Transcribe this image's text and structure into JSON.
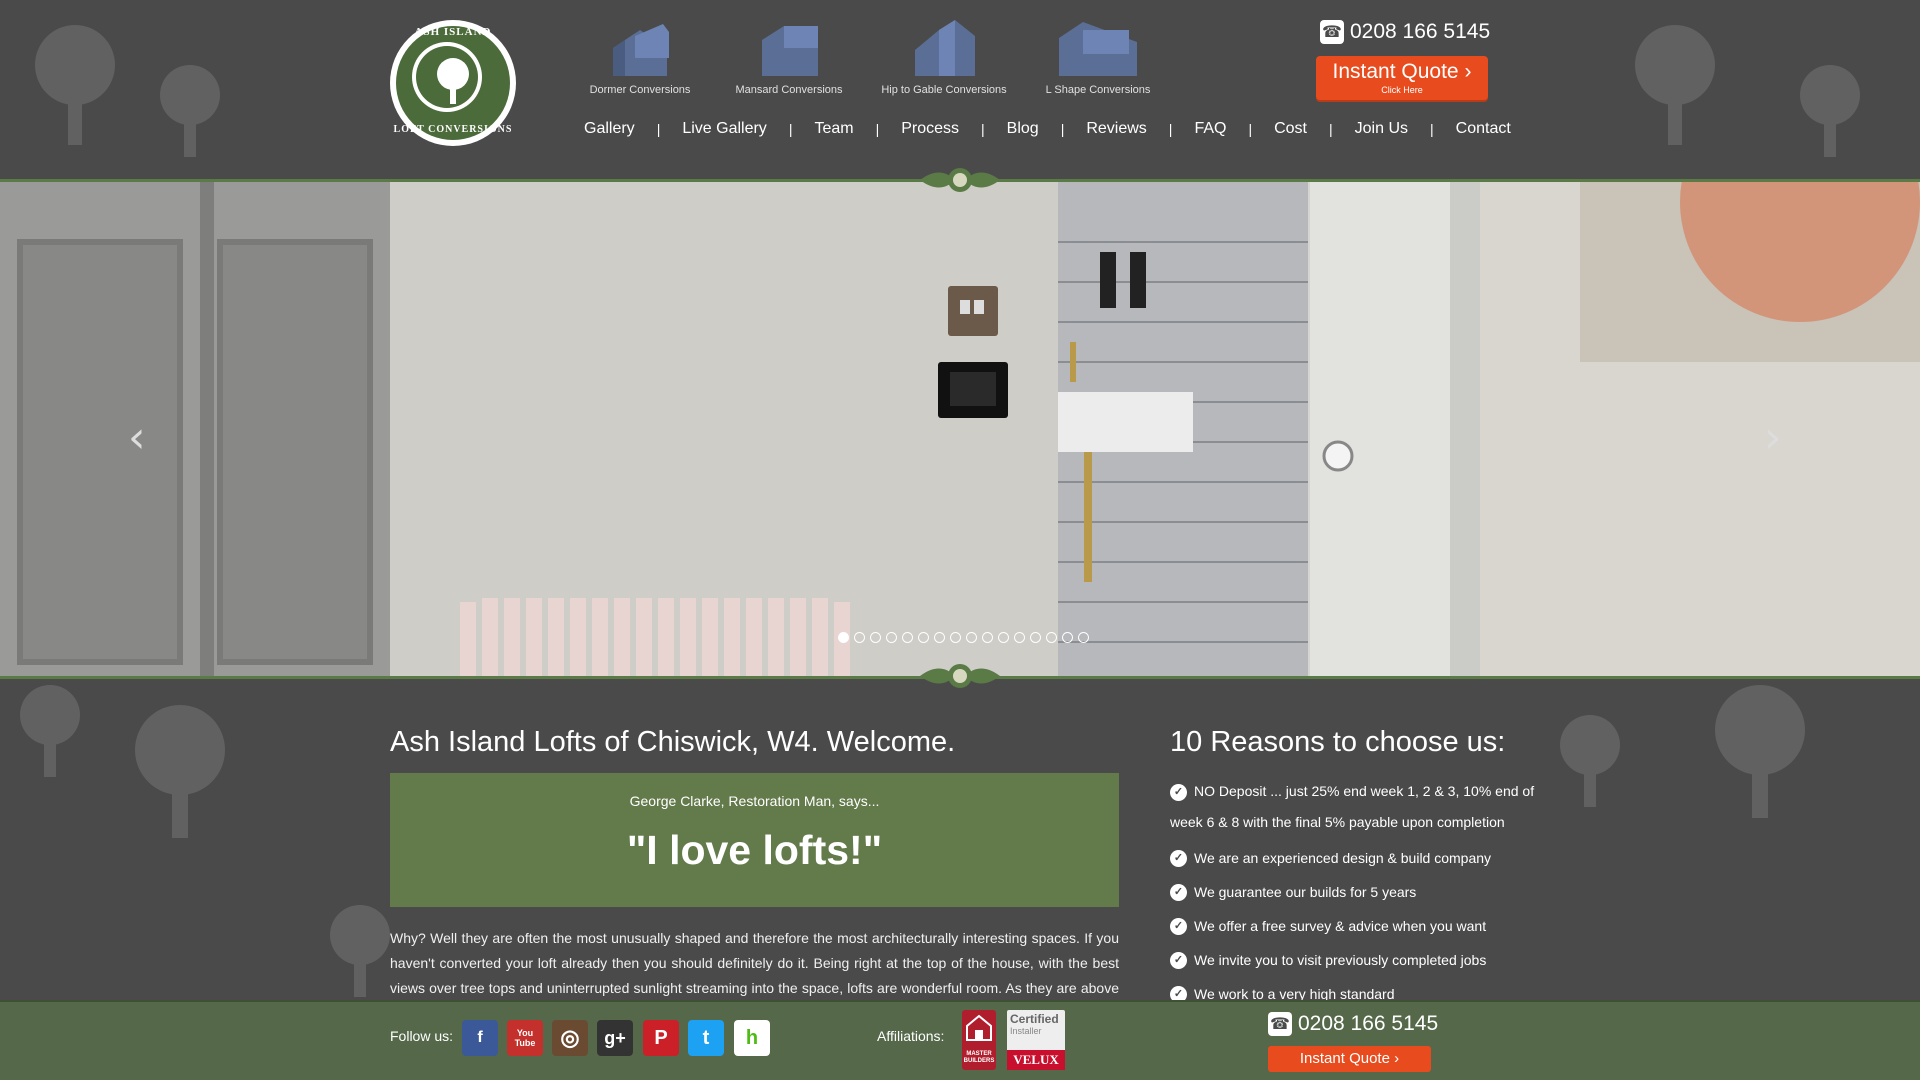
{
  "logo": {
    "top_text": "ASH ISLAND",
    "bottom_text": "LOFT CONVERSIONS"
  },
  "conversions": [
    {
      "label": "Dormer Conversions",
      "icon": "dormer-house-icon"
    },
    {
      "label": "Mansard Conversions",
      "icon": "mansard-house-icon"
    },
    {
      "label": "Hip to Gable Conversions",
      "icon": "hip-gable-house-icon"
    },
    {
      "label": "L Shape Conversions",
      "icon": "l-shape-house-icon"
    }
  ],
  "nav": [
    "Gallery",
    "Live Gallery",
    "Team",
    "Process",
    "Blog",
    "Reviews",
    "FAQ",
    "Cost",
    "Join Us",
    "Contact"
  ],
  "nav_separator": "|",
  "header": {
    "phone": "0208 166 5145",
    "quote_label": "Instant Quote ›",
    "quote_sub": "Click Here"
  },
  "slider": {
    "prev_symbol": "‹",
    "next_symbol": "›",
    "dot_count": 16,
    "active_dot": 0
  },
  "main": {
    "welcome": "Ash Island Lofts of Chiswick, W4. Welcome.",
    "quote_says": "George Clarke, Restoration Man, says...",
    "quote_big": "\"I love lofts!\"",
    "paragraph": "Why? Well they are often the most unusually shaped and therefore the most architecturally interesting spaces. If you haven't converted your loft already then you should definitely do it. Being right at the top of the house, with the best views over tree tops and uninterrupted sunlight streaming into the space, lofts are wonderful room. As they are above all of the"
  },
  "reasons": {
    "title": "10 Reasons to choose us:",
    "items": [
      "NO Deposit ... just 25% end week 1, 2 & 3, 10% end of",
      "week 6 & 8 with the final 5% payable upon completion",
      "We are an experienced design & build company",
      "We guarantee our builds for 5 years",
      "We offer a free survey & advice when you want",
      "We invite you to visit previously completed jobs",
      "We work to a very high standard"
    ]
  },
  "footer": {
    "follow_label": "Follow us:",
    "social": [
      {
        "name": "facebook",
        "glyph": "f",
        "color": "#3b5998"
      },
      {
        "name": "youtube",
        "glyph": "You Tube",
        "color": "#c4302b"
      },
      {
        "name": "instagram",
        "glyph": "◎",
        "color": "#6b4a32"
      },
      {
        "name": "google-plus",
        "glyph": "g+",
        "color": "#333333"
      },
      {
        "name": "pinterest",
        "glyph": "P",
        "color": "#cb2027"
      },
      {
        "name": "twitter",
        "glyph": "t",
        "color": "#1da1f2"
      },
      {
        "name": "houzz",
        "glyph": "h",
        "color": "#ffffff"
      }
    ],
    "affiliations_label": "Affiliations:",
    "mb_text": "MASTER BUILDERS",
    "velux_certified": "Certified",
    "velux_installer": "Installer",
    "velux_brand": "VELUX",
    "phone": "0208 166 5145",
    "quote_label": "Instant Quote ›"
  },
  "colors": {
    "background": "#4a4a4a",
    "green": "#637a4b",
    "accent_orange": "#e84c1e"
  }
}
